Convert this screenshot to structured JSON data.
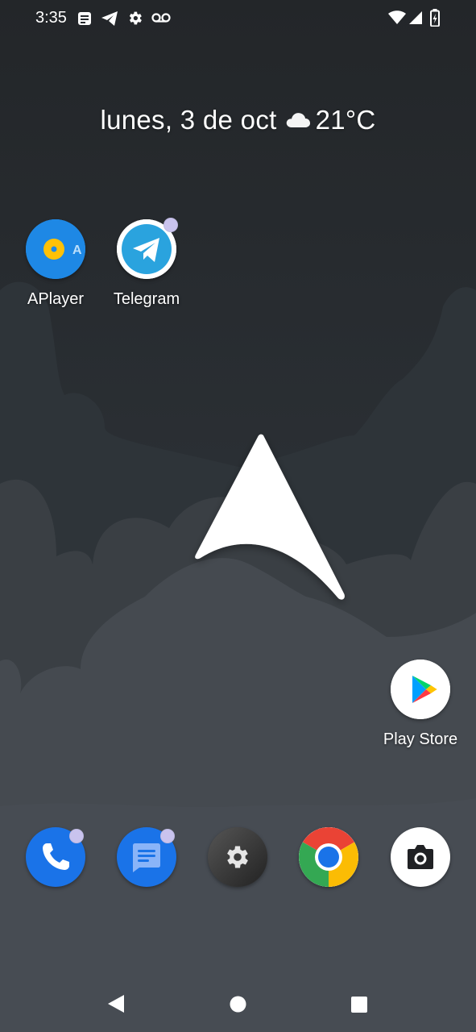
{
  "status_bar": {
    "time": "3:35",
    "left_icons": [
      "notes-icon",
      "telegram-send-icon",
      "gear-icon",
      "voicemail-icon"
    ],
    "right_icons": [
      "wifi-icon",
      "cell-signal-icon",
      "battery-charging-icon"
    ]
  },
  "glance": {
    "date": "lunes, 3 de oct",
    "weather_icon": "cloud-icon",
    "temperature": "21°C"
  },
  "home_apps": [
    {
      "label": "APlayer",
      "icon": "aplayer-icon",
      "color": "#1e88e5"
    },
    {
      "label": "Telegram",
      "icon": "telegram-icon",
      "color": "#2aa3de",
      "notification": true
    },
    {
      "label": "Play Store",
      "icon": "play-store-icon",
      "color": "#ffffff"
    }
  ],
  "dock": [
    {
      "name": "phone",
      "icon": "phone-icon",
      "color": "#1a73e8",
      "notification": true
    },
    {
      "name": "messages",
      "icon": "messages-icon",
      "color": "#1a73e8",
      "notification": true
    },
    {
      "name": "settings",
      "icon": "settings-icon",
      "color": "#3c3c3c"
    },
    {
      "name": "chrome",
      "icon": "chrome-icon"
    },
    {
      "name": "camera",
      "icon": "camera-icon",
      "color": "#ffffff"
    }
  ],
  "nav_bar": [
    "back-icon",
    "home-icon",
    "recents-icon"
  ],
  "colors": {
    "notification_dot": "#c9c3ee",
    "wallpaper_top": "#25282c",
    "wallpaper_bottom": "#4b5157"
  }
}
